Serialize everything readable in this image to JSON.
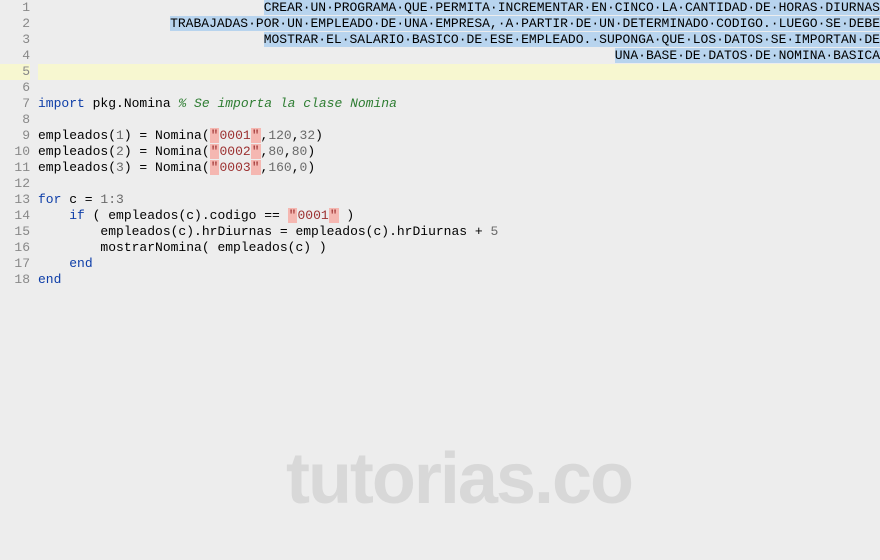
{
  "editor": {
    "line_count": 18,
    "current_line": 5,
    "watermark": "tutorias.co",
    "header": {
      "l1": "CREAR·UN·PROGRAMA·QUE·PERMITA·INCREMENTAR·EN·CINCO·LA·CANTIDAD·DE·HORAS·DIURNAS",
      "l2": "TRABAJADAS·POR·UN·EMPLEADO·DE·UNA·EMPRESA,·A·PARTIR·DE·UN·DETERMINADO·CODIGO.·LUEGO·SE·DEBE",
      "l3": "MOSTRAR·EL·SALARIO·BASICO·DE·ESE·EMPLEADO.·SUPONGA·QUE·LOS·DATOS·SE·IMPORTAN·DE",
      "l4": "UNA·BASE·DE·DATOS·DE·NOMINA·BASICA"
    },
    "code": {
      "l7": {
        "kw": "import",
        "pkg": " pkg.Nomina ",
        "cmt": "% Se importa la clase Nomina"
      },
      "l9": {
        "pre": "empleados(",
        "idx": "1",
        "mid": ") = Nomina(",
        "q1": "\"",
        "s": "0001",
        "q2": "\"",
        "c1": ",",
        "n1": "120",
        "c2": ",",
        "n2": "32",
        "end": ")"
      },
      "l10": {
        "pre": "empleados(",
        "idx": "2",
        "mid": ") = Nomina(",
        "q1": "\"",
        "s": "0002",
        "q2": "\"",
        "c1": ",",
        "n1": "80",
        "c2": ",",
        "n2": "80",
        "end": ")"
      },
      "l11": {
        "pre": "empleados(",
        "idx": "3",
        "mid": ") = Nomina(",
        "q1": "\"",
        "s": "0003",
        "q2": "\"",
        "c1": ",",
        "n1": "160",
        "c2": ",",
        "n2": "0",
        "end": ")"
      },
      "l13": {
        "kw": "for",
        "txt": " c = ",
        "range": "1:3"
      },
      "l14": {
        "indent": "    ",
        "kw": "if",
        "txt1": " ( empleados(c).codigo == ",
        "q1": "\"",
        "s": "0001",
        "q2": "\"",
        "txt2": " )"
      },
      "l15": {
        "indent": "        ",
        "txt1": "empleados(c).hrDiurnas = empleados(c).hrDiurnas + ",
        "n": "5"
      },
      "l16": {
        "indent": "        ",
        "txt": "mostrarNomina( empleados(c) )"
      },
      "l17": {
        "indent": "    ",
        "kw": "end"
      },
      "l18": {
        "kw": "end"
      }
    }
  }
}
